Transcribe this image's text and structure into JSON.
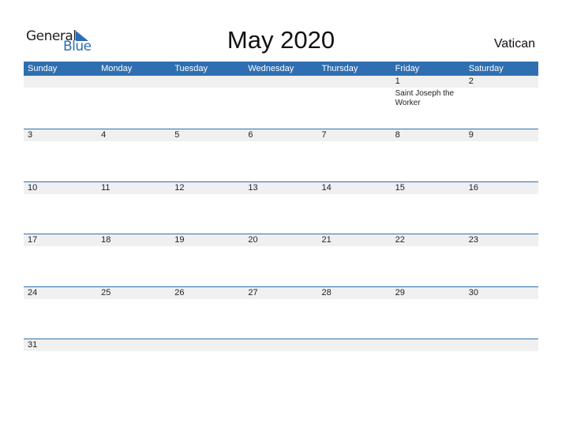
{
  "logo": {
    "general": "General",
    "blue": "Blue"
  },
  "title": "May 2020",
  "country": "Vatican",
  "weekdays": [
    "Sunday",
    "Monday",
    "Tuesday",
    "Wednesday",
    "Thursday",
    "Friday",
    "Saturday"
  ],
  "weeks": [
    [
      "",
      "",
      "",
      "",
      "",
      "1",
      "2"
    ],
    [
      "3",
      "4",
      "5",
      "6",
      "7",
      "8",
      "9"
    ],
    [
      "10",
      "11",
      "12",
      "13",
      "14",
      "15",
      "16"
    ],
    [
      "17",
      "18",
      "19",
      "20",
      "21",
      "22",
      "23"
    ],
    [
      "24",
      "25",
      "26",
      "27",
      "28",
      "29",
      "30"
    ],
    [
      "31",
      "",
      "",
      "",
      "",
      "",
      ""
    ]
  ],
  "events": [
    {
      "week": 0,
      "day": 5,
      "text": "Saint Joseph the Worker"
    }
  ],
  "colors": {
    "accent": "#2f6fb1",
    "strip": "#f0f0f0"
  }
}
